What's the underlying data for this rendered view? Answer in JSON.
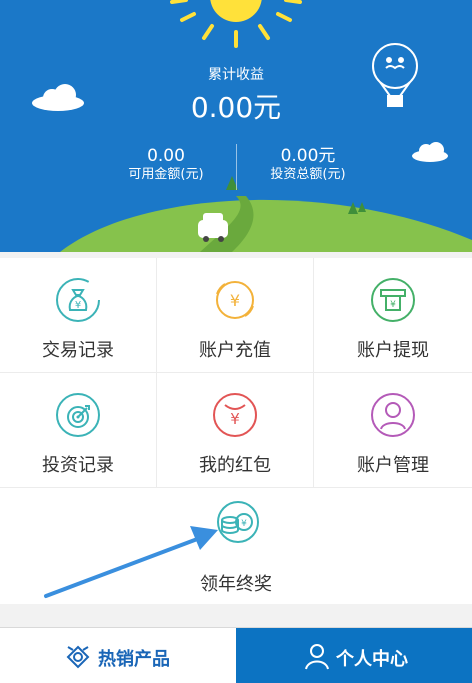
{
  "header": {
    "title": "累计收益",
    "total_amount": "0.00元",
    "available_amount": "0.00",
    "available_label": "可用金额(元)",
    "invest_total": "0.00元",
    "invest_label": "投资总额(元)"
  },
  "menu": {
    "trade_record": "交易记录",
    "recharge": "账户充值",
    "withdraw": "账户提现",
    "invest_record": "投资记录",
    "red_packet": "我的红包",
    "account_manage": "账户管理",
    "year_end_bonus": "领年终奖"
  },
  "icons": {
    "trade_record": "money-bag-yuan-icon",
    "recharge": "yuan-circle-icon",
    "withdraw": "atm-withdraw-icon",
    "invest_record": "target-icon",
    "red_packet": "red-packet-yuan-icon",
    "account_manage": "user-avatar-icon",
    "year_end_bonus": "coins-yuan-icon"
  },
  "bottom_nav": {
    "hot_products": "热销产品",
    "personal_center": "个人中心"
  },
  "colors": {
    "header_bg": "#1b78c8",
    "active_tab_bg": "#0c73c2",
    "teal": "#3bb3b7",
    "orange": "#f3b23a",
    "green": "#44b068",
    "red": "#e25555",
    "purple": "#b45ab8",
    "arrow": "#3a8fde"
  }
}
